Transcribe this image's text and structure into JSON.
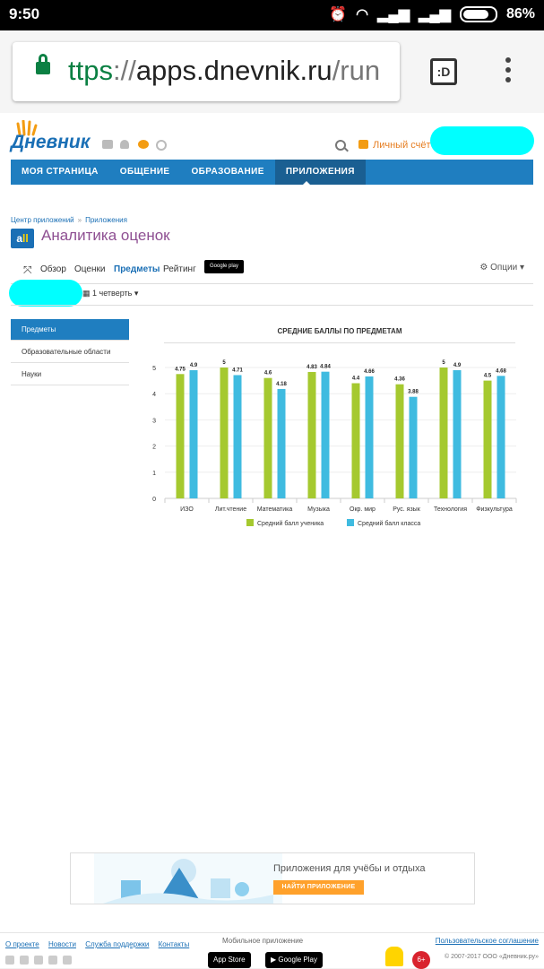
{
  "statusbar": {
    "time": "9:50",
    "battery": "86%"
  },
  "browser": {
    "url_scheme": "ttps",
    "url_sep": "://",
    "url_host": "apps.dnevnik.ru",
    "url_path": "/run",
    "tab_label": ":D"
  },
  "site": {
    "logo": "Дневник",
    "cabinet": "Личный счёт",
    "nav": [
      "МОЯ СТРАНИЦА",
      "ОБЩЕНИЕ",
      "ОБРАЗОВАНИЕ",
      "ПРИЛОЖЕНИЯ"
    ],
    "breadcrumb": [
      "Центр приложений",
      "Приложения"
    ],
    "app_logo": "a",
    "app_title": "Аналитика оценок",
    "tabs": [
      "Обзор",
      "Оценки",
      "Предметы",
      "Рейтинг"
    ],
    "gplay": "Google play",
    "options": "Опции",
    "period": "1 четверть"
  },
  "sidebar": [
    "Предметы",
    "Образовательные области",
    "Науки"
  ],
  "chart_data": {
    "type": "bar",
    "title": "СРЕДНИЕ БАЛЛЫ ПО ПРЕДМЕТАМ",
    "categories": [
      "ИЗО",
      "Лит.чтение",
      "Математика",
      "Музыка",
      "Окр. мир",
      "Рус. язык",
      "Технология",
      "Физкультура"
    ],
    "series": [
      {
        "name": "Средний балл ученика",
        "values": [
          4.75,
          5,
          4.6,
          4.83,
          4.4,
          4.36,
          5,
          4.5
        ],
        "color": "#a5c92f"
      },
      {
        "name": "Средний балл класса",
        "values": [
          4.9,
          4.71,
          4.18,
          4.84,
          4.66,
          3.88,
          4.9,
          4.68
        ],
        "color": "#3fbbe0"
      }
    ],
    "value_labels": [
      [
        "4.75",
        "4.9"
      ],
      [
        "5",
        "4.71"
      ],
      [
        "4.6",
        "4.18"
      ],
      [
        "4.83",
        "4.84"
      ],
      [
        "4.4",
        "4.66"
      ],
      [
        "4.36",
        "3.88"
      ],
      [
        "5",
        "4.9"
      ],
      [
        "4.5",
        "4.68"
      ]
    ],
    "yticks": [
      "0",
      "1",
      "2",
      "3",
      "4",
      "5"
    ],
    "ylim": [
      0,
      5
    ],
    "legend": "bottom"
  },
  "banner": {
    "text": "Приложения для учёбы и отдыха",
    "button": "НАЙТИ ПРИЛОЖЕНИЕ"
  },
  "footer": {
    "links": [
      "О проекте",
      "Новости",
      "Служба поддержки",
      "Контакты"
    ],
    "mobile": "Мобильное приложение",
    "appstore": "App Store",
    "googleplay": "Google Play",
    "terms": "Пользовательское соглашение",
    "copyright": "© 2007-2017 ООО «Дневник.ру»",
    "age": "6+"
  }
}
